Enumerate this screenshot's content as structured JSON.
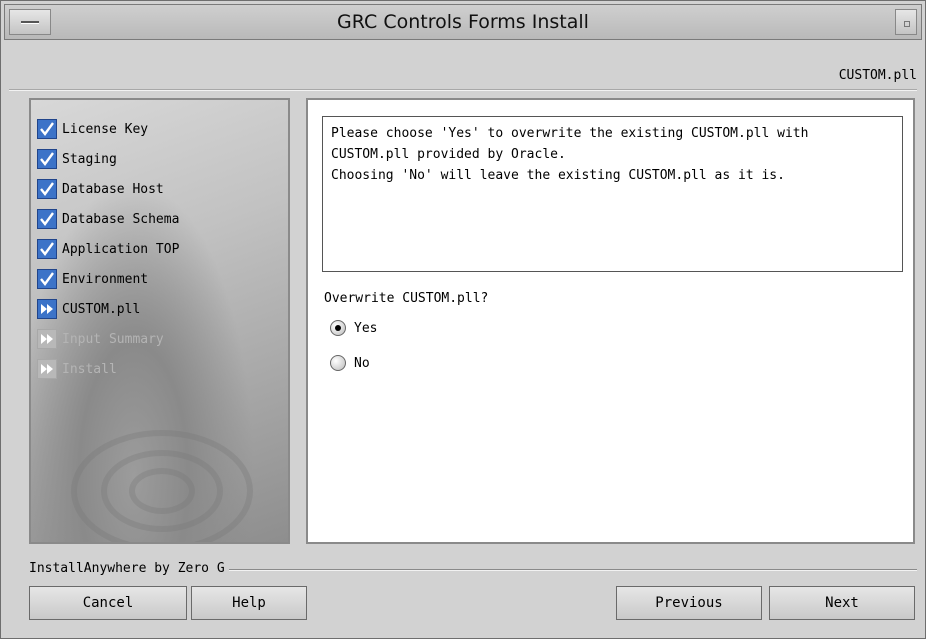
{
  "window": {
    "title": "GRC Controls Forms Install"
  },
  "step_header": "CUSTOM.pll",
  "steps": [
    {
      "label": "License Key",
      "state": "done",
      "icon": "checkmark-icon"
    },
    {
      "label": "Staging",
      "state": "done",
      "icon": "checkmark-icon"
    },
    {
      "label": "Database Host",
      "state": "done",
      "icon": "checkmark-icon"
    },
    {
      "label": "Database Schema",
      "state": "done",
      "icon": "checkmark-icon"
    },
    {
      "label": "Application TOP",
      "state": "done",
      "icon": "checkmark-icon"
    },
    {
      "label": "Environment",
      "state": "done",
      "icon": "checkmark-icon"
    },
    {
      "label": "CUSTOM.pll",
      "state": "current",
      "icon": "double-arrow-icon"
    },
    {
      "label": "Input Summary",
      "state": "pending",
      "icon": "double-arrow-icon"
    },
    {
      "label": "Install",
      "state": "pending",
      "icon": "double-arrow-icon"
    }
  ],
  "message": {
    "line1": "Please choose 'Yes' to overwrite the existing CUSTOM.pll with",
    "line2": "CUSTOM.pll provided by Oracle.",
    "line3": "Choosing 'No' will leave the existing CUSTOM.pll as it is."
  },
  "question": "Overwrite CUSTOM.pll?",
  "options": [
    {
      "label": "Yes",
      "selected": true
    },
    {
      "label": "No",
      "selected": false
    }
  ],
  "footer": {
    "brand": "InstallAnywhere by Zero G",
    "cancel_label": "Cancel",
    "help_label": "Help",
    "previous_label": "Previous",
    "next_label": "Next"
  },
  "colors": {
    "check_blue": "#3c73c8",
    "panel_white": "#ffffff",
    "window_gray": "#d2d2d2"
  }
}
